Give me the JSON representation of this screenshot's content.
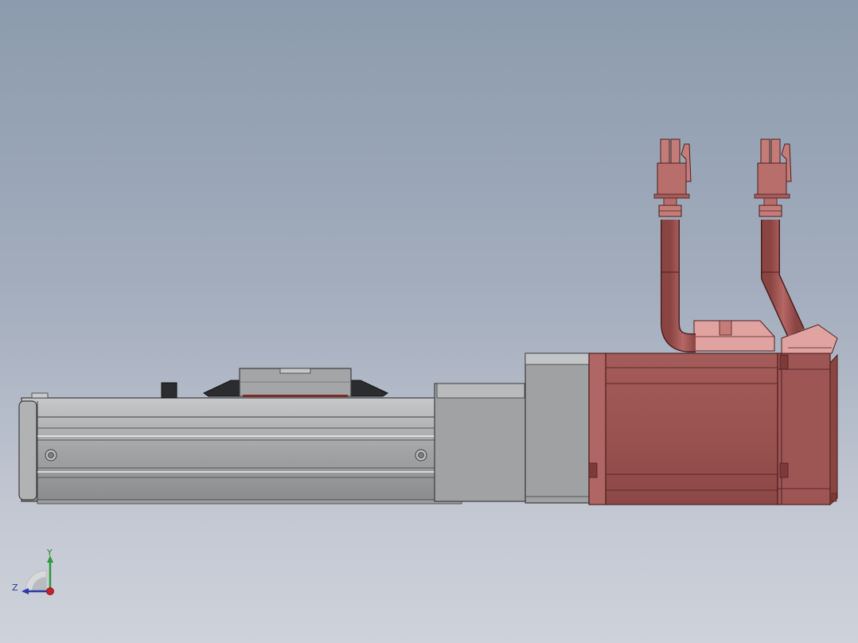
{
  "viewport": {
    "background_top": "#8c9bad",
    "background_bottom": "#cfd2da"
  },
  "model": {
    "components": [
      "actuator-rail",
      "carriage-slider",
      "motor-adapter-block",
      "servo-motor",
      "power-cable",
      "encoder-cable",
      "cable-connector-plug"
    ],
    "colors": {
      "rail_gray": "#a7a9ab",
      "rail_dark": "#6f7173",
      "adapter_gray": "#9fa1a3",
      "motor_red": "#9b5452",
      "motor_highlight": "#c07774",
      "connector_pink": "#e0a3a0",
      "carriage_black": "#2b2c2e"
    }
  },
  "triad": {
    "x_label": "",
    "y_label": "Y",
    "z_label": "Z",
    "colors": {
      "x": "#c8202a",
      "y": "#2a9a3a",
      "z": "#2a3aa8"
    }
  }
}
